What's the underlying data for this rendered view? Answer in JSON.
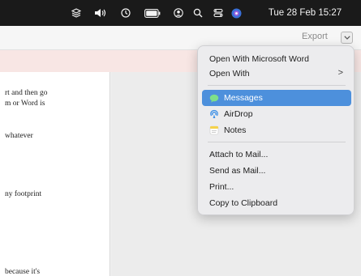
{
  "menubar": {
    "clock": "Tue 28 Feb  15:27",
    "icons": [
      "stack-icon",
      "volume-icon",
      "time-machine-icon",
      "battery-icon",
      "user-icon",
      "search-icon",
      "control-center-icon",
      "siri-icon"
    ]
  },
  "toolbar": {
    "export_label": "Export"
  },
  "document": {
    "lines": [
      "rt and then go",
      "m or Word is",
      "whatever",
      "ny footprint",
      "because it's"
    ]
  },
  "export_menu": {
    "items": [
      {
        "label": "Open With Microsoft Word",
        "icon": ""
      },
      {
        "label": "Open With",
        "icon": "",
        "submenu": ">"
      },
      {
        "label": "Messages",
        "icon": "messages-icon",
        "selected": true
      },
      {
        "label": "AirDrop",
        "icon": "airdrop-icon"
      },
      {
        "label": "Notes",
        "icon": "notes-icon"
      },
      {
        "label": "Attach to Mail...",
        "icon": ""
      },
      {
        "label": "Send as Mail...",
        "icon": ""
      },
      {
        "label": "Print...",
        "icon": ""
      },
      {
        "label": "Copy to Clipboard",
        "icon": ""
      }
    ]
  },
  "colors": {
    "menubar_bg": "#1a1a1a",
    "selection": "#4d90dc",
    "pink_strip": "#f8e6e4"
  }
}
